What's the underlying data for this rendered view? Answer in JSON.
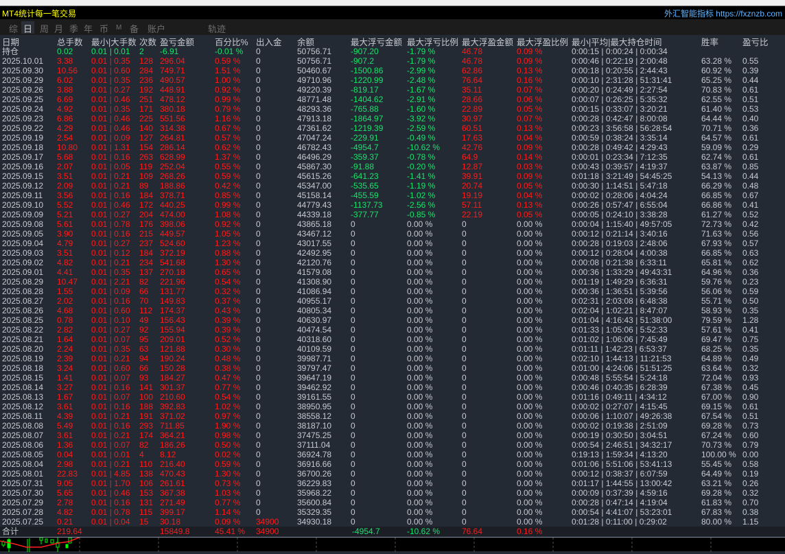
{
  "title": "MT4统计每一笔交易",
  "site": "外汇智能指标 https://fxznzb.com",
  "tabs": [
    "综",
    "日",
    "周",
    "月",
    "季",
    "年",
    "币",
    "M",
    "备",
    "账户",
    "轨迹"
  ],
  "active_tab": "日",
  "headers": [
    "日期",
    "总手数",
    "最小|大手数",
    "次数",
    "盈亏金额",
    "百分比%",
    "出入金",
    "余额",
    "最大浮亏金额",
    "最大浮亏比例",
    "最大浮盈金额",
    "最大浮盈比例",
    "最小|平均|最大持仓时间",
    "胜率",
    "盈亏比"
  ],
  "position": [
    "持仓",
    "0.02",
    "0.01 | 0.01",
    "2",
    "-6.91",
    "-0.01 %",
    "0",
    "50756.71",
    "-907.20",
    "-1.79 %",
    "46.78",
    "0.09 %",
    "0:00:15 | 0:00:24 | 0:00:34",
    "",
    ""
  ],
  "rows": [
    [
      "2025.10.01",
      "3.38",
      "0.01 | 0.35",
      "128",
      "296.04",
      "0.59 %",
      "0",
      "50756.71",
      "-907.2",
      "-1.79 %",
      "46.78",
      "0.09 %",
      "0:00:46 | 0:22:19 | 2:00:48",
      "63.28 %",
      "0.55"
    ],
    [
      "2025.09.30",
      "10.56",
      "0.01 | 0.60",
      "284",
      "749.71",
      "1.51 %",
      "0",
      "50460.67",
      "-1500.86",
      "-2.99 %",
      "62.86",
      "0.13 %",
      "0:00:18 | 0:20:55 | 2:44:43",
      "60.92 %",
      "0.39"
    ],
    [
      "2025.09.29",
      "6.02",
      "0.01 | 0.35",
      "236",
      "490.57",
      "1.00 %",
      "0",
      "49710.96",
      "-1220.99",
      "-2.48 %",
      "76.64",
      "0.16 %",
      "0:00:10 | 2:31:28 | 51:31:41",
      "65.25 %",
      "0.44"
    ],
    [
      "2025.09.26",
      "3.88",
      "0.01 | 0.27",
      "192",
      "448.91",
      "0.92 %",
      "0",
      "49220.39",
      "-819.17",
      "-1.67 %",
      "35.11",
      "0.07 %",
      "0:00:20 | 0:24:49 | 2:27:54",
      "70.83 %",
      "0.61"
    ],
    [
      "2025.09.25",
      "6.69",
      "0.01 | 0.46",
      "251",
      "478.12",
      "0.99 %",
      "0",
      "48771.48",
      "-1404.62",
      "-2.91 %",
      "28.66",
      "0.06 %",
      "0:00:07 | 0:26:25 | 5:35:32",
      "62.55 %",
      "0.51"
    ],
    [
      "2025.09.24",
      "4.92",
      "0.01 | 0.35",
      "171",
      "380.18",
      "0.79 %",
      "0",
      "48293.36",
      "-765.88",
      "-1.60 %",
      "22.89",
      "0.05 %",
      "0:00:15 | 0:33:07 | 3:20:21",
      "61.40 %",
      "0.53"
    ],
    [
      "2025.09.23",
      "6.86",
      "0.01 | 0.46",
      "225",
      "551.56",
      "1.16 %",
      "0",
      "47913.18",
      "-1864.97",
      "-3.92 %",
      "30.97",
      "0.07 %",
      "0:00:28 | 0:42:47 | 8:00:08",
      "64.44 %",
      "0.40"
    ],
    [
      "2025.09.22",
      "4.29",
      "0.01 | 0.46",
      "140",
      "314.38",
      "0.67 %",
      "0",
      "47361.62",
      "-1219.39",
      "-2.59 %",
      "60.51",
      "0.13 %",
      "0:00:23 | 3:56:58 | 56:28:54",
      "70.71 %",
      "0.36"
    ],
    [
      "2025.09.19",
      "2.54",
      "0.01 | 0.09",
      "127",
      "264.81",
      "0.57 %",
      "0",
      "47047.24",
      "-229.91",
      "-0.49 %",
      "17.63",
      "0.04 %",
      "0:00:59 | 0:38:24 | 3:35:14",
      "64.57 %",
      "0.61"
    ],
    [
      "2025.09.18",
      "10.80",
      "0.01 | 1.31",
      "154",
      "286.14",
      "0.62 %",
      "0",
      "46782.43",
      "-4954.7",
      "-10.62 %",
      "42.76",
      "0.09 %",
      "0:00:28 | 0:49:42 | 4:29:43",
      "59.09 %",
      "0.29"
    ],
    [
      "2025.09.17",
      "5.68",
      "0.01 | 0.16",
      "263",
      "628.99",
      "1.37 %",
      "0",
      "46496.29",
      "-359.37",
      "-0.78 %",
      "64.9",
      "0.14 %",
      "0:00:01 | 0:23:34 | 7:12:35",
      "62.74 %",
      "0.61"
    ],
    [
      "2025.09.16",
      "2.07",
      "0.01 | 0.05",
      "119",
      "252.04",
      "0.55 %",
      "0",
      "45867.30",
      "-91.88",
      "-0.20 %",
      "12.87",
      "0.03 %",
      "0:00:43 | 0:39:57 | 4:19:37",
      "63.87 %",
      "0.85"
    ],
    [
      "2025.09.15",
      "3.51",
      "0.01 | 0.21",
      "109",
      "268.26",
      "0.59 %",
      "0",
      "45615.26",
      "-641.23",
      "-1.41 %",
      "39.91",
      "0.09 %",
      "0:01:18 | 3:21:49 | 54:45:25",
      "54.13 %",
      "0.44"
    ],
    [
      "2025.09.12",
      "2.09",
      "0.01 | 0.21",
      "89",
      "188.86",
      "0.42 %",
      "0",
      "45347.00",
      "-535.65",
      "-1.19 %",
      "20.74",
      "0.05 %",
      "0:00:30 | 1:14:51 | 5:47:18",
      "66.29 %",
      "0.48"
    ],
    [
      "2025.09.11",
      "3.56",
      "0.01 | 0.16",
      "184",
      "378.71",
      "0.85 %",
      "0",
      "45158.14",
      "-455.59",
      "-1.02 %",
      "19.19",
      "0.04 %",
      "0:00:02 | 0:28:06 | 4:04:24",
      "66.85 %",
      "0.67"
    ],
    [
      "2025.09.10",
      "5.52",
      "0.01 | 0.46",
      "172",
      "440.25",
      "0.99 %",
      "0",
      "44779.43",
      "-1137.73",
      "-2.56 %",
      "57.11",
      "0.13 %",
      "0:00:26 | 0:57:47 | 6:55:04",
      "66.86 %",
      "0.41"
    ],
    [
      "2025.09.09",
      "5.21",
      "0.01 | 0.27",
      "204",
      "474.00",
      "1.08 %",
      "0",
      "44339.18",
      "-377.77",
      "-0.85 %",
      "22.19",
      "0.05 %",
      "0:00:05 | 0:24:10 | 3:38:28",
      "61.27 %",
      "0.52"
    ],
    [
      "2025.09.08",
      "5.61",
      "0.01 | 0.78",
      "176",
      "398.06",
      "0.92 %",
      "0",
      "43865.18",
      "0",
      "0.00 %",
      "0",
      "0.00 %",
      "0:00:04 | 1:15:40 | 49:57:05",
      "72.73 %",
      "0.42"
    ],
    [
      "2025.09.05",
      "3.90",
      "0.01 | 0.16",
      "215",
      "449.57",
      "1.05 %",
      "0",
      "43467.12",
      "0",
      "0.00 %",
      "0",
      "0.00 %",
      "0:00:12 | 0:21:14 | 3:40:16",
      "71.63 %",
      "0.56"
    ],
    [
      "2025.09.04",
      "4.79",
      "0.01 | 0.27",
      "237",
      "524.60",
      "1.23 %",
      "0",
      "43017.55",
      "0",
      "0.00 %",
      "0",
      "0.00 %",
      "0:00:28 | 0:19:03 | 2:48:06",
      "67.93 %",
      "0.57"
    ],
    [
      "2025.09.03",
      "3.51",
      "0.01 | 0.12",
      "184",
      "372.19",
      "0.88 %",
      "0",
      "42492.95",
      "0",
      "0.00 %",
      "0",
      "0.00 %",
      "0:00:12 | 0:28:04 | 4:00:38",
      "66.85 %",
      "0.63"
    ],
    [
      "2025.09.02",
      "4.82",
      "0.01 | 0.21",
      "234",
      "541.68",
      "1.30 %",
      "0",
      "42120.76",
      "0",
      "0.00 %",
      "0",
      "0.00 %",
      "0:00:08 | 0:21:38 | 6:33:11",
      "65.81 %",
      "0.62"
    ],
    [
      "2025.09.01",
      "4.41",
      "0.01 | 0.35",
      "137",
      "270.18",
      "0.65 %",
      "0",
      "41579.08",
      "0",
      "0.00 %",
      "0",
      "0.00 %",
      "0:00:36 | 1:33:29 | 49:43:31",
      "64.96 %",
      "0.36"
    ],
    [
      "2025.08.29",
      "10.47",
      "0.01 | 2.21",
      "82",
      "221.96",
      "0.54 %",
      "0",
      "41308.90",
      "0",
      "0.00 %",
      "0",
      "0.00 %",
      "0:01:19 | 1:49:29 | 6:36:31",
      "59.76 %",
      "0.23"
    ],
    [
      "2025.08.28",
      "1.55",
      "0.01 | 0.09",
      "66",
      "131.77",
      "0.32 %",
      "0",
      "41086.94",
      "0",
      "0.00 %",
      "0",
      "0.00 %",
      "0:00:36 | 1:36:51 | 5:39:56",
      "56.06 %",
      "0.59"
    ],
    [
      "2025.08.27",
      "2.02",
      "0.01 | 0.16",
      "70",
      "149.83",
      "0.37 %",
      "0",
      "40955.17",
      "0",
      "0.00 %",
      "0",
      "0.00 %",
      "0:02:31 | 2:03:08 | 6:48:38",
      "55.71 %",
      "0.50"
    ],
    [
      "2025.08.26",
      "4.68",
      "0.01 | 0.60",
      "112",
      "174.37",
      "0.43 %",
      "0",
      "40805.34",
      "0",
      "0.00 %",
      "0",
      "0.00 %",
      "0:02:04 | 1:02:21 | 8:47:07",
      "58.93 %",
      "0.35"
    ],
    [
      "2025.08.25",
      "0.78",
      "0.01 | 0.10",
      "49",
      "156.43",
      "0.39 %",
      "0",
      "40630.97",
      "0",
      "0.00 %",
      "0",
      "0.00 %",
      "0:01:04 | 4:16:43 | 51:38:00",
      "79.59 %",
      "1.28"
    ],
    [
      "2025.08.22",
      "2.82",
      "0.01 | 0.27",
      "92",
      "155.94",
      "0.39 %",
      "0",
      "40474.54",
      "0",
      "0.00 %",
      "0",
      "0.00 %",
      "0:01:33 | 1:05:06 | 5:52:33",
      "57.61 %",
      "0.41"
    ],
    [
      "2025.08.21",
      "1.64",
      "0.01 | 0.07",
      "95",
      "209.01",
      "0.52 %",
      "0",
      "40318.60",
      "0",
      "0.00 %",
      "0",
      "0.00 %",
      "0:01:02 | 1:06:06 | 7:45:49",
      "69.47 %",
      "0.75"
    ],
    [
      "2025.08.20",
      "2.24",
      "0.01 | 0.35",
      "63",
      "121.88",
      "0.30 %",
      "0",
      "40109.59",
      "0",
      "0.00 %",
      "0",
      "0.00 %",
      "0:01:11 | 1:42:23 | 6:53:37",
      "68.25 %",
      "0.35"
    ],
    [
      "2025.08.19",
      "2.39",
      "0.01 | 0.21",
      "94",
      "190.24",
      "0.48 %",
      "0",
      "39987.71",
      "0",
      "0.00 %",
      "0",
      "0.00 %",
      "0:02:10 | 1:44:13 | 11:21:53",
      "64.89 %",
      "0.49"
    ],
    [
      "2025.08.18",
      "3.24",
      "0.01 | 0.60",
      "66",
      "150.28",
      "0.38 %",
      "0",
      "39797.47",
      "0",
      "0.00 %",
      "0",
      "0.00 %",
      "0:01:00 | 4:24:06 | 51:51:25",
      "63.64 %",
      "0.32"
    ],
    [
      "2025.08.15",
      "1.41",
      "0.01 | 0.07",
      "93",
      "184.27",
      "0.47 %",
      "0",
      "39647.19",
      "0",
      "0.00 %",
      "0",
      "0.00 %",
      "0:00:48 | 5:55:54 | 5:24:18",
      "72.04 %",
      "0.93"
    ],
    [
      "2025.08.14",
      "3.27",
      "0.01 | 0.16",
      "141",
      "301.37",
      "0.77 %",
      "0",
      "39462.92",
      "0",
      "0.00 %",
      "0",
      "0.00 %",
      "0:00:46 | 0:40:35 | 6:28:39",
      "67.38 %",
      "0.45"
    ],
    [
      "2025.08.13",
      "1.67",
      "0.01 | 0.07",
      "100",
      "210.60",
      "0.54 %",
      "0",
      "39161.55",
      "0",
      "0.00 %",
      "0",
      "0.00 %",
      "0:01:16 | 0:49:11 | 4:34:12",
      "67.00 %",
      "0.90"
    ],
    [
      "2025.08.12",
      "3.61",
      "0.01 | 0.16",
      "188",
      "392.83",
      "1.02 %",
      "0",
      "38950.95",
      "0",
      "0.00 %",
      "0",
      "0.00 %",
      "0:00:02 | 0:27:07 | 4:15:45",
      "69.15 %",
      "0.61"
    ],
    [
      "2025.08.11",
      "4.39",
      "0.01 | 0.21",
      "191",
      "371.02",
      "0.97 %",
      "0",
      "38558.12",
      "0",
      "0.00 %",
      "0",
      "0.00 %",
      "0:00:06 | 1:10:07 | 49:26:38",
      "67.54 %",
      "0.51"
    ],
    [
      "2025.08.08",
      "5.49",
      "0.01 | 0.16",
      "293",
      "711.85",
      "1.90 %",
      "0",
      "38187.10",
      "0",
      "0.00 %",
      "0",
      "0.00 %",
      "0:00:02 | 0:19:38 | 2:51:09",
      "69.28 %",
      "0.73"
    ],
    [
      "2025.08.07",
      "3.61",
      "0.01 | 0.21",
      "174",
      "364.21",
      "0.98 %",
      "0",
      "37475.25",
      "0",
      "0.00 %",
      "0",
      "0.00 %",
      "0:00:19 | 0:30:50 | 3:04:51",
      "67.24 %",
      "0.60"
    ],
    [
      "2025.08.06",
      "1.36",
      "0.01 | 0.07",
      "82",
      "186.26",
      "0.50 %",
      "0",
      "37111.04",
      "0",
      "0.00 %",
      "0",
      "0.00 %",
      "0:00:54 | 2:46:51 | 34:32:17",
      "70.73 %",
      "0.79"
    ],
    [
      "2025.08.05",
      "0.04",
      "0.01 | 0.01",
      "4",
      "8.12",
      "0.02 %",
      "0",
      "36924.78",
      "0",
      "0.00 %",
      "0",
      "0.00 %",
      "0:19:13 | 1:59:34 | 4:13:20",
      "100.00 %",
      "0.00"
    ],
    [
      "2025.08.04",
      "2.98",
      "0.01 | 0.21",
      "110",
      "216.40",
      "0.59 %",
      "0",
      "36916.66",
      "0",
      "0.00 %",
      "0",
      "0.00 %",
      "0:01:06 | 5:51:06 | 53:41:13",
      "55.45 %",
      "0.58"
    ],
    [
      "2025.08.01",
      "22.83",
      "0.01 | 4.85",
      "138",
      "470.43",
      "1.30 %",
      "0",
      "36700.26",
      "0",
      "0.00 %",
      "0",
      "0.00 %",
      "0:00:12 | 0:38:37 | 6:07:59",
      "64.49 %",
      "0.19"
    ],
    [
      "2025.07.31",
      "9.05",
      "0.01 | 1.70",
      "106",
      "261.61",
      "0.73 %",
      "0",
      "36229.83",
      "0",
      "0.00 %",
      "0",
      "0.00 %",
      "0:01:17 | 1:44:55 | 13:00:42",
      "63.21 %",
      "0.26"
    ],
    [
      "2025.07.30",
      "5.65",
      "0.01 | 0.46",
      "153",
      "367.38",
      "1.03 %",
      "0",
      "35968.22",
      "0",
      "0.00 %",
      "0",
      "0.00 %",
      "0:00:09 | 0:37:39 | 4:59:16",
      "69.28 %",
      "0.32"
    ],
    [
      "2025.07.29",
      "2.78",
      "0.01 | 0.16",
      "131",
      "271.49",
      "0.77 %",
      "0",
      "35600.84",
      "0",
      "0.00 %",
      "0",
      "0.00 %",
      "0:00:28 | 0:47:14 | 4:19:04",
      "61.83 %",
      "0.70"
    ],
    [
      "2025.07.28",
      "4.82",
      "0.01 | 0.78",
      "115",
      "399.17",
      "1.14 %",
      "0",
      "35329.35",
      "0",
      "0.00 %",
      "0",
      "0.00 %",
      "0:00:54 | 4:41:07 | 53:23:01",
      "67.83 %",
      "0.38"
    ],
    [
      "2025.07.25",
      "0.21",
      "0.01 | 0.04",
      "15",
      "30.18",
      "0.09 %",
      "34900",
      "34930.18",
      "0",
      "0.00 %",
      "0",
      "0.00 %",
      "0:01:28 | 0:11:00 | 0:29:02",
      "80.00 %",
      "1.15"
    ]
  ],
  "totals": {
    "label": "合计",
    "lots": "219.64",
    "pnl": "15849.8",
    "pct": "45.41 %",
    "io": "34900",
    "max_float_loss": "-4954.7",
    "max_float_loss_pct": "-10.62 %",
    "max_float_gain": "76.64",
    "max_float_gain_pct": "0.16 %"
  },
  "colors": {
    "profit": "#ff1a1a",
    "loss": "#19e36c",
    "text": "#c6cbd3",
    "title": "#ffff00",
    "link": "#5fb4ff"
  }
}
